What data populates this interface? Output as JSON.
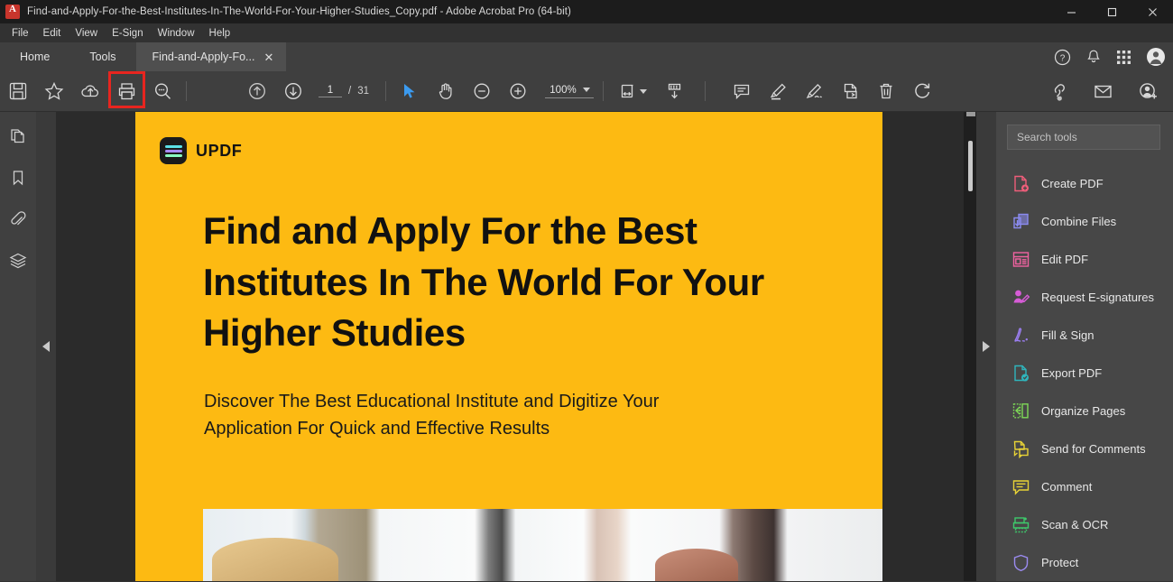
{
  "window": {
    "title": "Find-and-Apply-For-the-Best-Institutes-In-The-World-For-Your-Higher-Studies_Copy.pdf - Adobe Acrobat Pro (64-bit)",
    "app_icon": "acrobat-icon",
    "minimize": "—",
    "maximize": "☐",
    "close": "✕"
  },
  "menubar": {
    "items": [
      {
        "label": "File"
      },
      {
        "label": "Edit"
      },
      {
        "label": "View"
      },
      {
        "label": "E-Sign"
      },
      {
        "label": "Window"
      },
      {
        "label": "Help"
      }
    ]
  },
  "tabbar": {
    "tabs": [
      {
        "label": "Home",
        "name": "tab-home"
      },
      {
        "label": "Tools",
        "name": "tab-tools"
      },
      {
        "label": "Find-and-Apply-Fo...",
        "name": "tab-document",
        "active": true,
        "close": "✕"
      }
    ],
    "right_icons": [
      {
        "name": "help-icon",
        "label": "?"
      },
      {
        "name": "notification-bell-icon",
        "label": "bell"
      },
      {
        "name": "app-grid-icon",
        "label": "grid"
      },
      {
        "name": "user-avatar",
        "label": "avatar"
      }
    ]
  },
  "toolbar": {
    "left_tools": [
      {
        "name": "save-icon",
        "label": "Save"
      },
      {
        "name": "star-icon",
        "label": "Add to favorites"
      },
      {
        "name": "upload-cloud-icon",
        "label": "Save to cloud"
      },
      {
        "name": "print-icon",
        "label": "Print",
        "highlighted": true
      },
      {
        "name": "search-icon",
        "label": "Find"
      }
    ],
    "nav": {
      "previous_page_icon": "arrow-up-circle-icon",
      "next_page_icon": "arrow-down-circle-icon",
      "page_number": "1",
      "page_separator": "/",
      "page_total": "31"
    },
    "view_tools": [
      {
        "name": "select-cursor-icon",
        "label": "Select",
        "active": true
      },
      {
        "name": "hand-tool-icon",
        "label": "Pan"
      },
      {
        "name": "zoom-out-icon",
        "label": "Zoom out"
      },
      {
        "name": "zoom-in-icon",
        "label": "Zoom in"
      }
    ],
    "zoom_level": "100%",
    "fit_tools": [
      {
        "name": "fit-width-icon",
        "label": "Fit width"
      },
      {
        "name": "scroll-mode-icon",
        "label": "Page display"
      }
    ],
    "annotate_tools": [
      {
        "name": "comment-icon",
        "label": "Add comment"
      },
      {
        "name": "highlight-icon",
        "label": "Highlight text"
      },
      {
        "name": "sign-icon",
        "label": "Sign"
      },
      {
        "name": "stamp-icon",
        "label": "Stamp"
      },
      {
        "name": "delete-icon",
        "label": "Delete"
      },
      {
        "name": "rotate-icon",
        "label": "Rotate"
      }
    ],
    "right_tools": [
      {
        "name": "share-link-icon",
        "label": "Share link"
      },
      {
        "name": "email-icon",
        "label": "Email"
      },
      {
        "name": "add-person-icon",
        "label": "Invite people"
      }
    ]
  },
  "leftrail": {
    "items": [
      {
        "name": "page-thumbnails-icon",
        "label": "Page thumbnails"
      },
      {
        "name": "bookmarks-icon",
        "label": "Bookmarks"
      },
      {
        "name": "attachments-icon",
        "label": "Attachments"
      },
      {
        "name": "layers-icon",
        "label": "Layers"
      }
    ],
    "collapse_left": "◀",
    "collapse_right": "▶"
  },
  "document": {
    "logo_text": "UPDF",
    "heading": "Find and Apply For the Best Institutes In The World For Your Higher Studies",
    "subtitle": "Discover The Best Educational Institute and Digitize Your Application For Quick and Effective Results",
    "background_color": "#FDBA12",
    "logo_wave_colors": [
      "#5ce1e6",
      "#a78bfa",
      "#8affc1"
    ]
  },
  "toolspanel": {
    "search": {
      "placeholder": "Search tools"
    },
    "tools": [
      {
        "label": "Create PDF",
        "name": "tool-create-pdf",
        "color": "#ef5e7a",
        "icon": "create-pdf-icon"
      },
      {
        "label": "Combine Files",
        "name": "tool-combine-files",
        "color": "#8b8bf0",
        "icon": "combine-files-icon"
      },
      {
        "label": "Edit PDF",
        "name": "tool-edit-pdf",
        "color": "#f062a0",
        "icon": "edit-pdf-icon"
      },
      {
        "label": "Request E-signatures",
        "name": "tool-request-esignatures",
        "color": "#d65cd6",
        "icon": "request-esignatures-icon"
      },
      {
        "label": "Fill & Sign",
        "name": "tool-fill-sign",
        "color": "#9b7ef0",
        "icon": "fill-sign-icon"
      },
      {
        "label": "Export PDF",
        "name": "tool-export-pdf",
        "color": "#2fb6bd",
        "icon": "export-pdf-icon"
      },
      {
        "label": "Organize Pages",
        "name": "tool-organize-pages",
        "color": "#7ed957",
        "icon": "organize-pages-icon"
      },
      {
        "label": "Send for Comments",
        "name": "tool-send-for-comments",
        "color": "#e8d336",
        "icon": "send-for-comments-icon"
      },
      {
        "label": "Comment",
        "name": "tool-comment",
        "color": "#e8d336",
        "icon": "comment-tool-icon"
      },
      {
        "label": "Scan & OCR",
        "name": "tool-scan-ocr",
        "color": "#3ec96b",
        "icon": "scan-ocr-icon"
      },
      {
        "label": "Protect",
        "name": "tool-protect",
        "color": "#9b8bf0",
        "icon": "protect-shield-icon"
      }
    ]
  }
}
